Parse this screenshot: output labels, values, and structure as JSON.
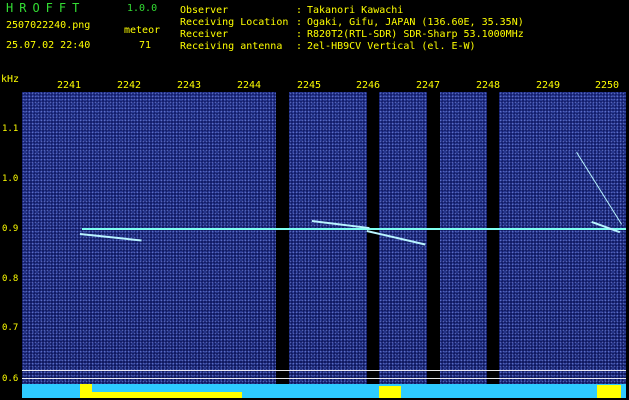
{
  "app": {
    "title": "HROFFT",
    "version": "1.0.0"
  },
  "file": {
    "name": "2507022240.png",
    "timestamp": "25.07.02 22:40"
  },
  "mode": {
    "label": "meteor",
    "count": "71"
  },
  "meta": [
    {
      "label": "Observer",
      "value": "Takanori Kawachi"
    },
    {
      "label": "Receiving Location",
      "value": "Ogaki, Gifu, JAPAN (136.60E, 35.35N)"
    },
    {
      "label": "Receiver",
      "value": "R820T2(RTL-SDR) SDR-Sharp 53.1000MHz"
    },
    {
      "label": "Receiving antenna",
      "value": "2el-HB9CV Vertical (el. E-W)"
    }
  ],
  "axis": {
    "unit": "kHz",
    "y_ticks": [
      "1.1",
      "1.0",
      "0.9",
      "0.8",
      "0.7",
      "0.6"
    ],
    "x_ticks": [
      "2241",
      "2242",
      "2243",
      "2244",
      "2245",
      "2246",
      "2247",
      "2248",
      "2249",
      "2250"
    ]
  },
  "colors": {
    "text": "#ffff00",
    "title": "#33dd33",
    "background": "#000000",
    "waterfall": "#0b145a",
    "carrier": "#7ffff0",
    "level_base": "#2ecbff",
    "level_peak": "#ffff00"
  }
}
